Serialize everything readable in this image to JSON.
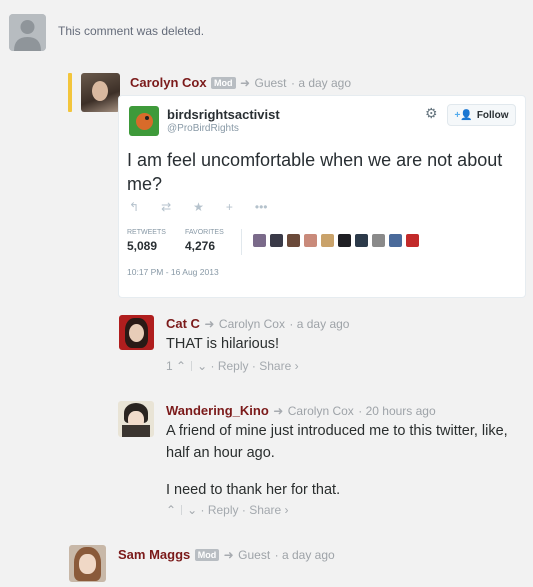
{
  "deleted": {
    "text": "This comment was deleted."
  },
  "comments": [
    {
      "author": "Carolyn Cox",
      "badge": "Mod",
      "reply_to": "Guest",
      "time": "a day ago"
    },
    {
      "author": "Cat C",
      "reply_to": "Carolyn Cox",
      "time": "a day ago",
      "body": "THAT is hilarious!",
      "votes": "1",
      "reply_label": "Reply",
      "share_label": "Share ›"
    },
    {
      "author": "Wandering_Kino",
      "reply_to": "Carolyn Cox",
      "time": "20 hours ago",
      "body_lines": [
        "A friend of mine just introduced me to this twitter, like,",
        "half an hour ago.",
        "I need to thank her for that."
      ],
      "reply_label": "Reply",
      "share_label": "Share ›"
    },
    {
      "author": "Sam Maggs",
      "badge": "Mod",
      "reply_to": "Guest",
      "time": "a day ago"
    }
  ],
  "tweet": {
    "name": "birdsrightsactivist",
    "handle": "@ProBirdRights",
    "follow_label": "Follow",
    "text": "I am feel uncomfortable when we are not about me?",
    "retweets_label": "RETWEETS",
    "retweets": "5,089",
    "favorites_label": "FAVORITES",
    "favorites": "4,276",
    "date": "10:17 PM - 16 Aug 2013"
  },
  "colors": {
    "author": "#7b1a1a",
    "mod_bar": "#f3c53b",
    "background": "#f2f2f2"
  },
  "icons": [
    "user-placeholder-icon",
    "reply-arrow-icon",
    "gear-icon",
    "follow-person-icon",
    "twitter-reply-icon",
    "retweet-icon",
    "star-icon",
    "more-icon",
    "upvote-icon",
    "downvote-icon"
  ]
}
